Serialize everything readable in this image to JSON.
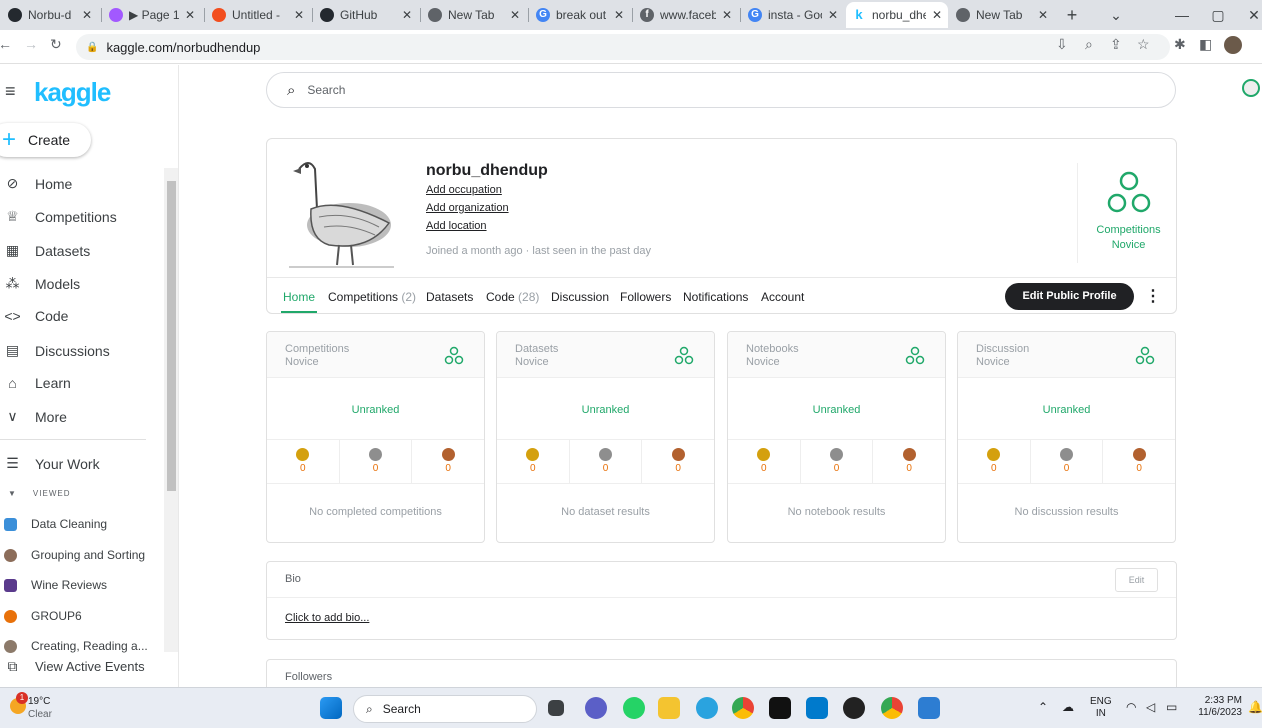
{
  "browser": {
    "tabs": [
      {
        "label": "Norbu-d",
        "icon": "github-icon",
        "color": "#24292f"
      },
      {
        "label": "▶ Page 1 -",
        "icon": "figma-icon",
        "color": "#a259ff"
      },
      {
        "label": "Untitled - ",
        "icon": "figma-icon",
        "color": "#f24e1e"
      },
      {
        "label": "GitHub",
        "icon": "github-icon",
        "color": "#24292f"
      },
      {
        "label": "New Tab",
        "icon": "chrome-icon",
        "color": "#5f6368"
      },
      {
        "label": "break out",
        "icon": "google-icon",
        "color": "#4285f4"
      },
      {
        "label": "www.faceb",
        "icon": "facebook-icon",
        "color": "#5f6368"
      },
      {
        "label": "insta - Goo",
        "icon": "google-icon",
        "color": "#4285f4"
      },
      {
        "label": "norbu_dhe",
        "icon": "kaggle-icon",
        "color": "#20beff"
      },
      {
        "label": "New Tab",
        "icon": "chrome-icon",
        "color": "#5f6368"
      }
    ],
    "url": "kaggle.com/norbudhendup"
  },
  "sidebar": {
    "logo": "kaggle",
    "create": "Create",
    "items": [
      {
        "label": "Home",
        "icon": "compass-icon"
      },
      {
        "label": "Competitions",
        "icon": "trophy-icon"
      },
      {
        "label": "Datasets",
        "icon": "table-icon"
      },
      {
        "label": "Models",
        "icon": "models-icon"
      },
      {
        "label": "Code",
        "icon": "code-icon"
      },
      {
        "label": "Discussions",
        "icon": "discussion-icon"
      },
      {
        "label": "Learn",
        "icon": "graduation-icon"
      },
      {
        "label": "More",
        "icon": "chevron-down-icon"
      },
      {
        "label": "Your Work",
        "icon": "list-icon"
      }
    ],
    "viewed_label": "VIEWED",
    "viewed": [
      {
        "label": "Data Cleaning",
        "color": "#3b8fd9"
      },
      {
        "label": "Grouping and Sorting",
        "color": "#8c6d5a"
      },
      {
        "label": "Wine Reviews",
        "color": "#5a3a8c"
      },
      {
        "label": "GROUP6",
        "color": "#e8710a"
      },
      {
        "label": "Creating, Reading a...",
        "color": "#8c7a6a"
      }
    ],
    "events": "View Active Events"
  },
  "search": {
    "placeholder": "Search"
  },
  "profile": {
    "username": "norbu_dhendup",
    "occupation": "Add occupation",
    "organization": "Add organization",
    "location": "Add location",
    "joined": "Joined a month ago · last seen in the past day",
    "tier_title": "Competitions",
    "tier_level": "Novice",
    "tabs": [
      {
        "label": "Home",
        "count": ""
      },
      {
        "label": "Competitions",
        "count": "(2)"
      },
      {
        "label": "Datasets",
        "count": ""
      },
      {
        "label": "Code",
        "count": "(28)"
      },
      {
        "label": "Discussion",
        "count": ""
      },
      {
        "label": "Followers",
        "count": ""
      },
      {
        "label": "Notifications",
        "count": ""
      },
      {
        "label": "Account",
        "count": ""
      }
    ],
    "edit": "Edit Public Profile"
  },
  "cards": [
    {
      "title": "Competitions",
      "level": "Novice",
      "rank": "Unranked",
      "gold": "0",
      "silver": "0",
      "bronze": "0",
      "empty": "No completed competitions"
    },
    {
      "title": "Datasets",
      "level": "Novice",
      "rank": "Unranked",
      "gold": "0",
      "silver": "0",
      "bronze": "0",
      "empty": "No dataset results"
    },
    {
      "title": "Notebooks",
      "level": "Novice",
      "rank": "Unranked",
      "gold": "0",
      "silver": "0",
      "bronze": "0",
      "empty": "No notebook results"
    },
    {
      "title": "Discussion",
      "level": "Novice",
      "rank": "Unranked",
      "gold": "0",
      "silver": "0",
      "bronze": "0",
      "empty": "No discussion results"
    }
  ],
  "bio": {
    "title": "Bio",
    "edit": "Edit",
    "add": "Click to add bio..."
  },
  "followers": {
    "title": "Followers"
  },
  "taskbar": {
    "weather_temp": "19°C",
    "weather_desc": "Clear",
    "weather_badge": "1",
    "search": "Search",
    "lang1": "ENG",
    "lang2": "IN",
    "time": "2:33 PM",
    "date": "11/6/2023"
  },
  "colors": {
    "kaggle_blue": "#20beff",
    "novice_green": "#20a86a",
    "gold": "#d4a00e",
    "silver": "#8e8e8e",
    "bronze": "#b2612f"
  }
}
